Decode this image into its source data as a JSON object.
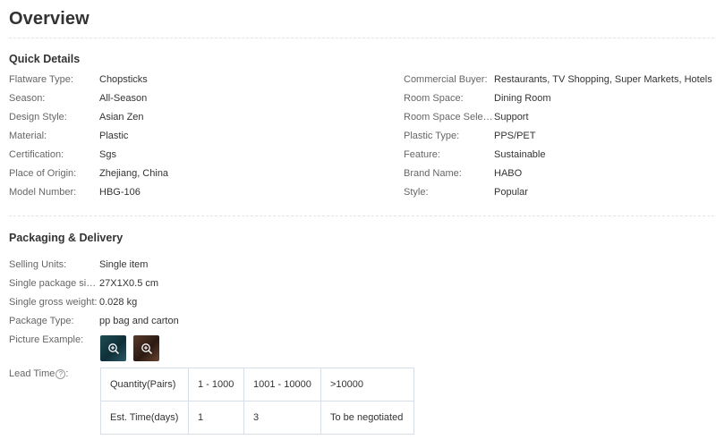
{
  "page": {
    "title": "Overview"
  },
  "quick_details": {
    "title": "Quick Details",
    "left": [
      {
        "label": "Flatware Type:",
        "value": "Chopsticks"
      },
      {
        "label": "Season:",
        "value": "All-Season"
      },
      {
        "label": "Design Style:",
        "value": "Asian Zen"
      },
      {
        "label": "Material:",
        "value": "Plastic"
      },
      {
        "label": "Certification:",
        "value": "Sgs"
      },
      {
        "label": "Place of Origin:",
        "value": "Zhejiang, China"
      },
      {
        "label": "Model Number:",
        "value": "HBG-106"
      }
    ],
    "right": [
      {
        "label": "Commercial Buyer:",
        "value": "Restaurants, TV Shopping, Super Markets, Hotels"
      },
      {
        "label": "Room Space:",
        "value": "Dining Room"
      },
      {
        "label": "Room Space Select...",
        "value": "Support"
      },
      {
        "label": "Plastic Type:",
        "value": "PPS/PET"
      },
      {
        "label": "Feature:",
        "value": "Sustainable"
      },
      {
        "label": "Brand Name:",
        "value": "HABO"
      },
      {
        "label": "Style:",
        "value": "Popular"
      }
    ]
  },
  "packaging": {
    "title": "Packaging & Delivery",
    "rows": [
      {
        "label": "Selling Units:",
        "value": "Single item"
      },
      {
        "label": "Single package size:",
        "value": "27X1X0.5 cm"
      },
      {
        "label": "Single gross weight:",
        "value": "0.028 kg"
      },
      {
        "label": "Package Type:",
        "value": "pp bag and carton"
      }
    ],
    "picture_example_label": "Picture Example:",
    "lead_time_label": "Lead Time",
    "help_glyph": "?",
    "lead_time_table": {
      "rows": [
        [
          "Quantity(Pairs)",
          "1 - 1000",
          "1001 - 10000",
          ">10000"
        ],
        [
          "Est. Time(days)",
          "1",
          "3",
          "To be negotiated"
        ]
      ]
    }
  },
  "icons": {
    "thumb_1": "zoom-in-icon",
    "thumb_2": "zoom-in-icon",
    "lead_help": "help-circle-icon"
  }
}
